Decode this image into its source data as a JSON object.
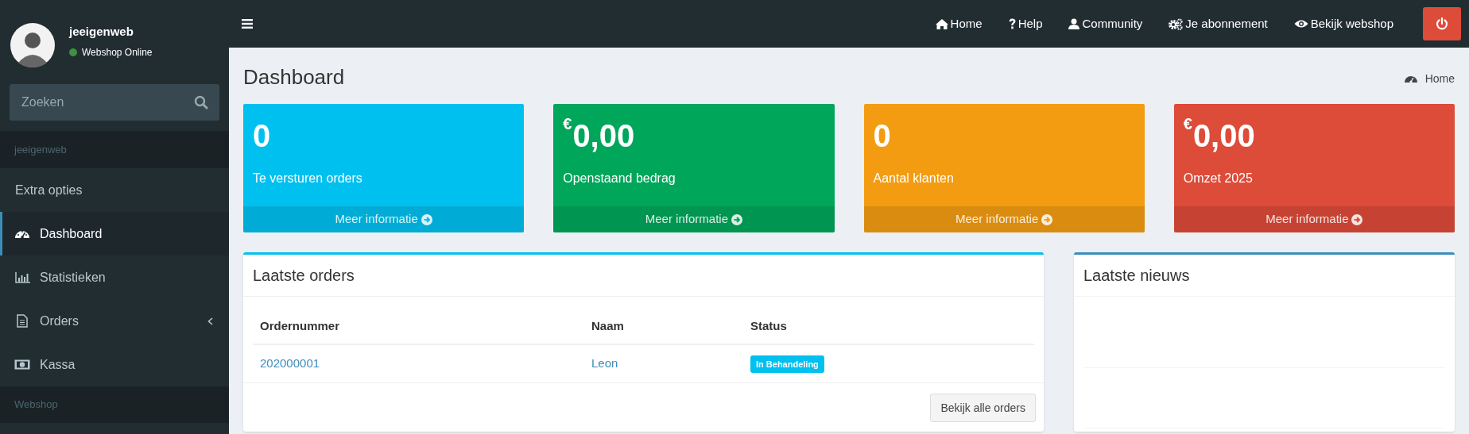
{
  "sidebar": {
    "user": {
      "name": "jeeigenweb",
      "status": "Webshop Online",
      "online": true
    },
    "search": {
      "placeholder": "Zoeken"
    },
    "items": [
      {
        "kind": "header",
        "label": "jeeigenweb"
      },
      {
        "kind": "link",
        "label": "Extra opties",
        "selected": false
      },
      {
        "kind": "link",
        "label": "Dashboard",
        "selected": true
      },
      {
        "kind": "link",
        "label": "Statistieken",
        "selected": false
      },
      {
        "kind": "submenu",
        "label": "Orders",
        "selected": false,
        "expanded": false
      },
      {
        "kind": "link",
        "label": "Kassa",
        "selected": false
      },
      {
        "kind": "header",
        "label": "Webshop"
      }
    ]
  },
  "topbar": {
    "links": [
      "Home",
      "Help",
      "Community",
      "Je abonnement",
      "Bekijk webshop"
    ]
  },
  "page": {
    "title": "Dashboard",
    "breadcrumb": "Home"
  },
  "stats": [
    {
      "value": "0",
      "label": "Te versturen orders",
      "link": "Meer informatie",
      "color": "#00c0ef"
    },
    {
      "value": "$^{€}$0,00",
      "label": "Openstaand bedrag",
      "link": "Meer informatie",
      "color": "#00a65a"
    },
    {
      "value": "0",
      "label": "Aantal klanten",
      "link": "Meer informatie",
      "color": "#f39c12"
    },
    {
      "value": "$^{€}$0,00",
      "label": "Omzet 2025",
      "link": "Meer informatie",
      "color": "#dd4b39"
    }
  ],
  "orders": {
    "title": "Laatste orders",
    "columns": [
      "Ordernummer",
      "Naam",
      "Status"
    ],
    "rows": [
      {
        "ordernummer": "202000001",
        "naam": "Leon",
        "status": "In Behandeling"
      }
    ],
    "button": "Bekijk alle orders"
  },
  "news": {
    "title": "Laatste nieuws"
  }
}
